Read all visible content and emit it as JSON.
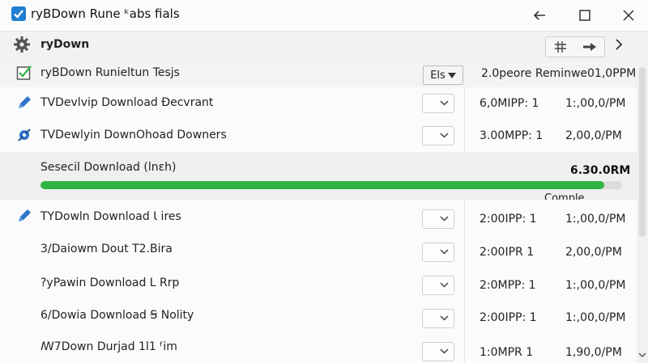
{
  "window": {
    "title": "ryBDown Rune ᵏabs fials",
    "minimize_symbol": "←",
    "maximize_symbol": "□",
    "close_symbol": "✕"
  },
  "toolbar": {
    "app_name": "ryDown",
    "icons": [
      "gear-icon",
      "hash-icon",
      "arrow-right-icon",
      "chevron-right-icon"
    ]
  },
  "list": {
    "header": {
      "name": "ryBDown Runieltun Tesjs",
      "button_label": "Els",
      "info": "2.0peore Reminwe01,0PPM"
    },
    "rows": [
      {
        "name": "TVDevlvip Download Ɖecvrant",
        "size": "6,0MIPP: 1",
        "time": "1:,00,0/PM",
        "icon": "pen-icon"
      },
      {
        "name": "TVDewlyin DownOhoad Downers",
        "size": "3.00MPP: 1",
        "time": "2,00,0/PM",
        "icon": "settings-icon"
      }
    ],
    "active": {
      "name": "Sesecil Download (lnɛh)",
      "time": "6.30.0RM",
      "status": "Comple",
      "progress": 0.97
    },
    "rows2": [
      {
        "name": "TYDowln Download Ɩ ires",
        "size": "2:00IPP: 1",
        "time": "1:,00,0/PM",
        "icon": "pen-icon"
      },
      {
        "name": "3/Daiowm Dout T2.Bira",
        "size": "2:00IPR 1",
        "time": "2,00,0/PM",
        "icon": ""
      },
      {
        "name": "?yPawin Download L Rrp",
        "size": "2:0MPP: 1",
        "time": "1:,00,0/PM",
        "icon": ""
      },
      {
        "name": "6/Dowia Download Ꞩ Nolity",
        "size": "2:00IPP: 1",
        "time": "1:,00,0/PM",
        "icon": ""
      },
      {
        "name": "ꟿ7Down Durjad 1l1 ᶠim",
        "size": "1:0MPR 1",
        "time": "1,90,0/PM",
        "icon": ""
      }
    ]
  },
  "colors": {
    "accent": "#1f7fd1",
    "progress": "#2fb344"
  }
}
